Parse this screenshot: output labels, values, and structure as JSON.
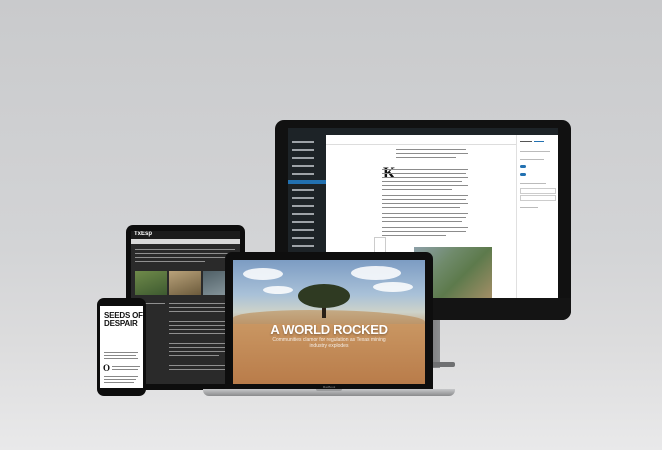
{
  "macbook": {
    "headline": "A WORLD ROCKED",
    "subhead": "Communities clamor for regulation as Texas mining industry explodes",
    "brand": "MacBook"
  },
  "phone": {
    "headline": "SEEDS OF DESPAIR",
    "dropcap": "O"
  },
  "ipad": {
    "logo": "TxEsp"
  },
  "imac": {
    "dropcap": "K"
  },
  "colors": {
    "wp_admin_dark": "#1d2327",
    "wp_accent": "#2271b1",
    "device_black": "#0e0e0e",
    "backdrop_gray": "#d3d4d6"
  }
}
